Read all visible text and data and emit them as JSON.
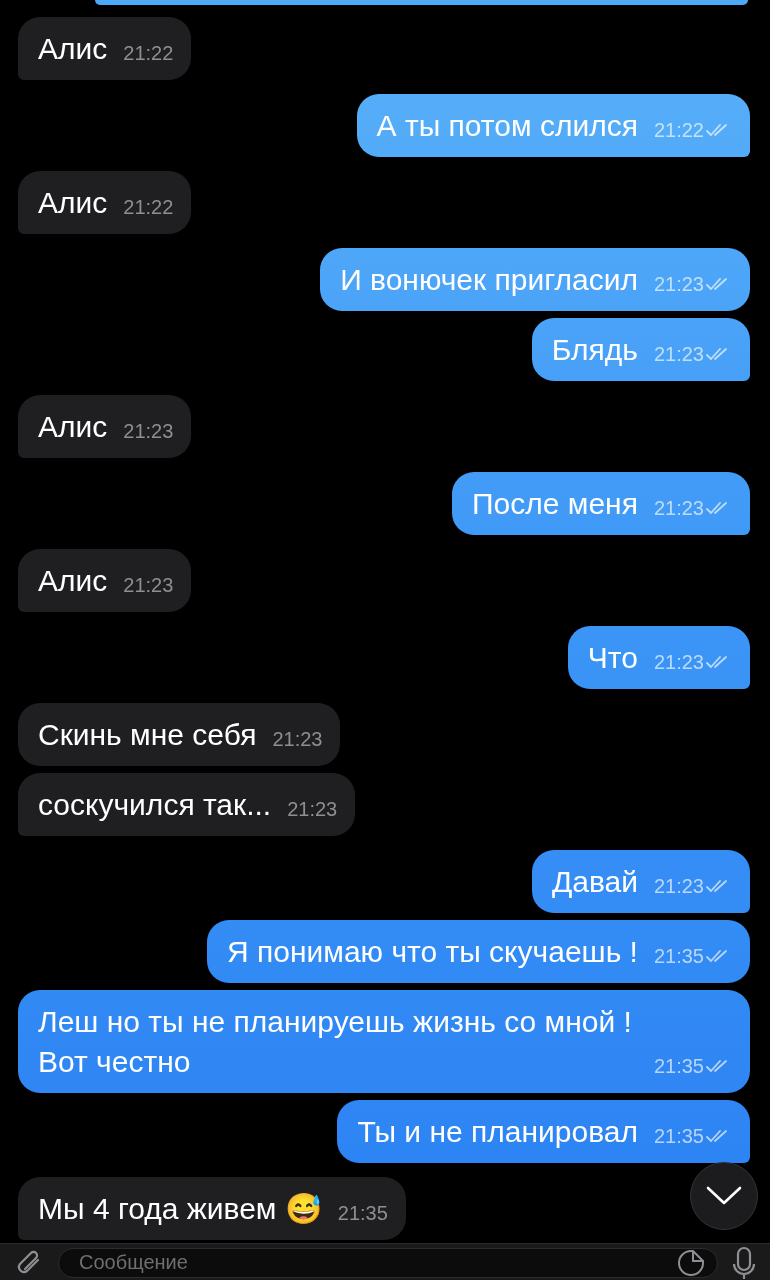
{
  "messages": [
    {
      "kind": "in",
      "text": "Алис",
      "time": "21:22",
      "tail": true
    },
    {
      "kind": "out",
      "text": "А ты потом слился",
      "time": "21:22",
      "read": true,
      "tail": true
    },
    {
      "kind": "in",
      "text": "Алис",
      "time": "21:22",
      "tail": true
    },
    {
      "kind": "out",
      "text": "И вонючек пригласил",
      "time": "21:23",
      "read": true,
      "tail": false
    },
    {
      "kind": "out",
      "text": "Блядь",
      "time": "21:23",
      "read": true,
      "tail": true
    },
    {
      "kind": "in",
      "text": "Алис",
      "time": "21:23",
      "tail": true
    },
    {
      "kind": "out",
      "text": "После меня",
      "time": "21:23",
      "read": true,
      "tail": true
    },
    {
      "kind": "in",
      "text": "Алис",
      "time": "21:23",
      "tail": true
    },
    {
      "kind": "out",
      "text": "Что",
      "time": "21:23",
      "read": true,
      "tail": true
    },
    {
      "kind": "in",
      "text": "Скинь мне себя",
      "time": "21:23",
      "tail": false
    },
    {
      "kind": "in",
      "text": "соскучился так...",
      "time": "21:23",
      "tail": true
    },
    {
      "kind": "out",
      "text": "Давай",
      "time": "21:23",
      "read": true,
      "tail": true
    },
    {
      "kind": "out",
      "text": "Я понимаю что ты скучаешь !",
      "time": "21:35",
      "read": true,
      "tail": false
    },
    {
      "kind": "out",
      "text": "Леш но ты не планируешь жизнь со мной ! Вот честно",
      "time": "21:35",
      "read": true,
      "tail": false
    },
    {
      "kind": "out",
      "text": "Ты и не планировал",
      "time": "21:35",
      "read": true,
      "tail": true
    },
    {
      "kind": "in",
      "text": "Мы 4 года живем 😅",
      "time": "21:35",
      "tail": true
    }
  ],
  "composer": {
    "placeholder": "Сообщение"
  }
}
